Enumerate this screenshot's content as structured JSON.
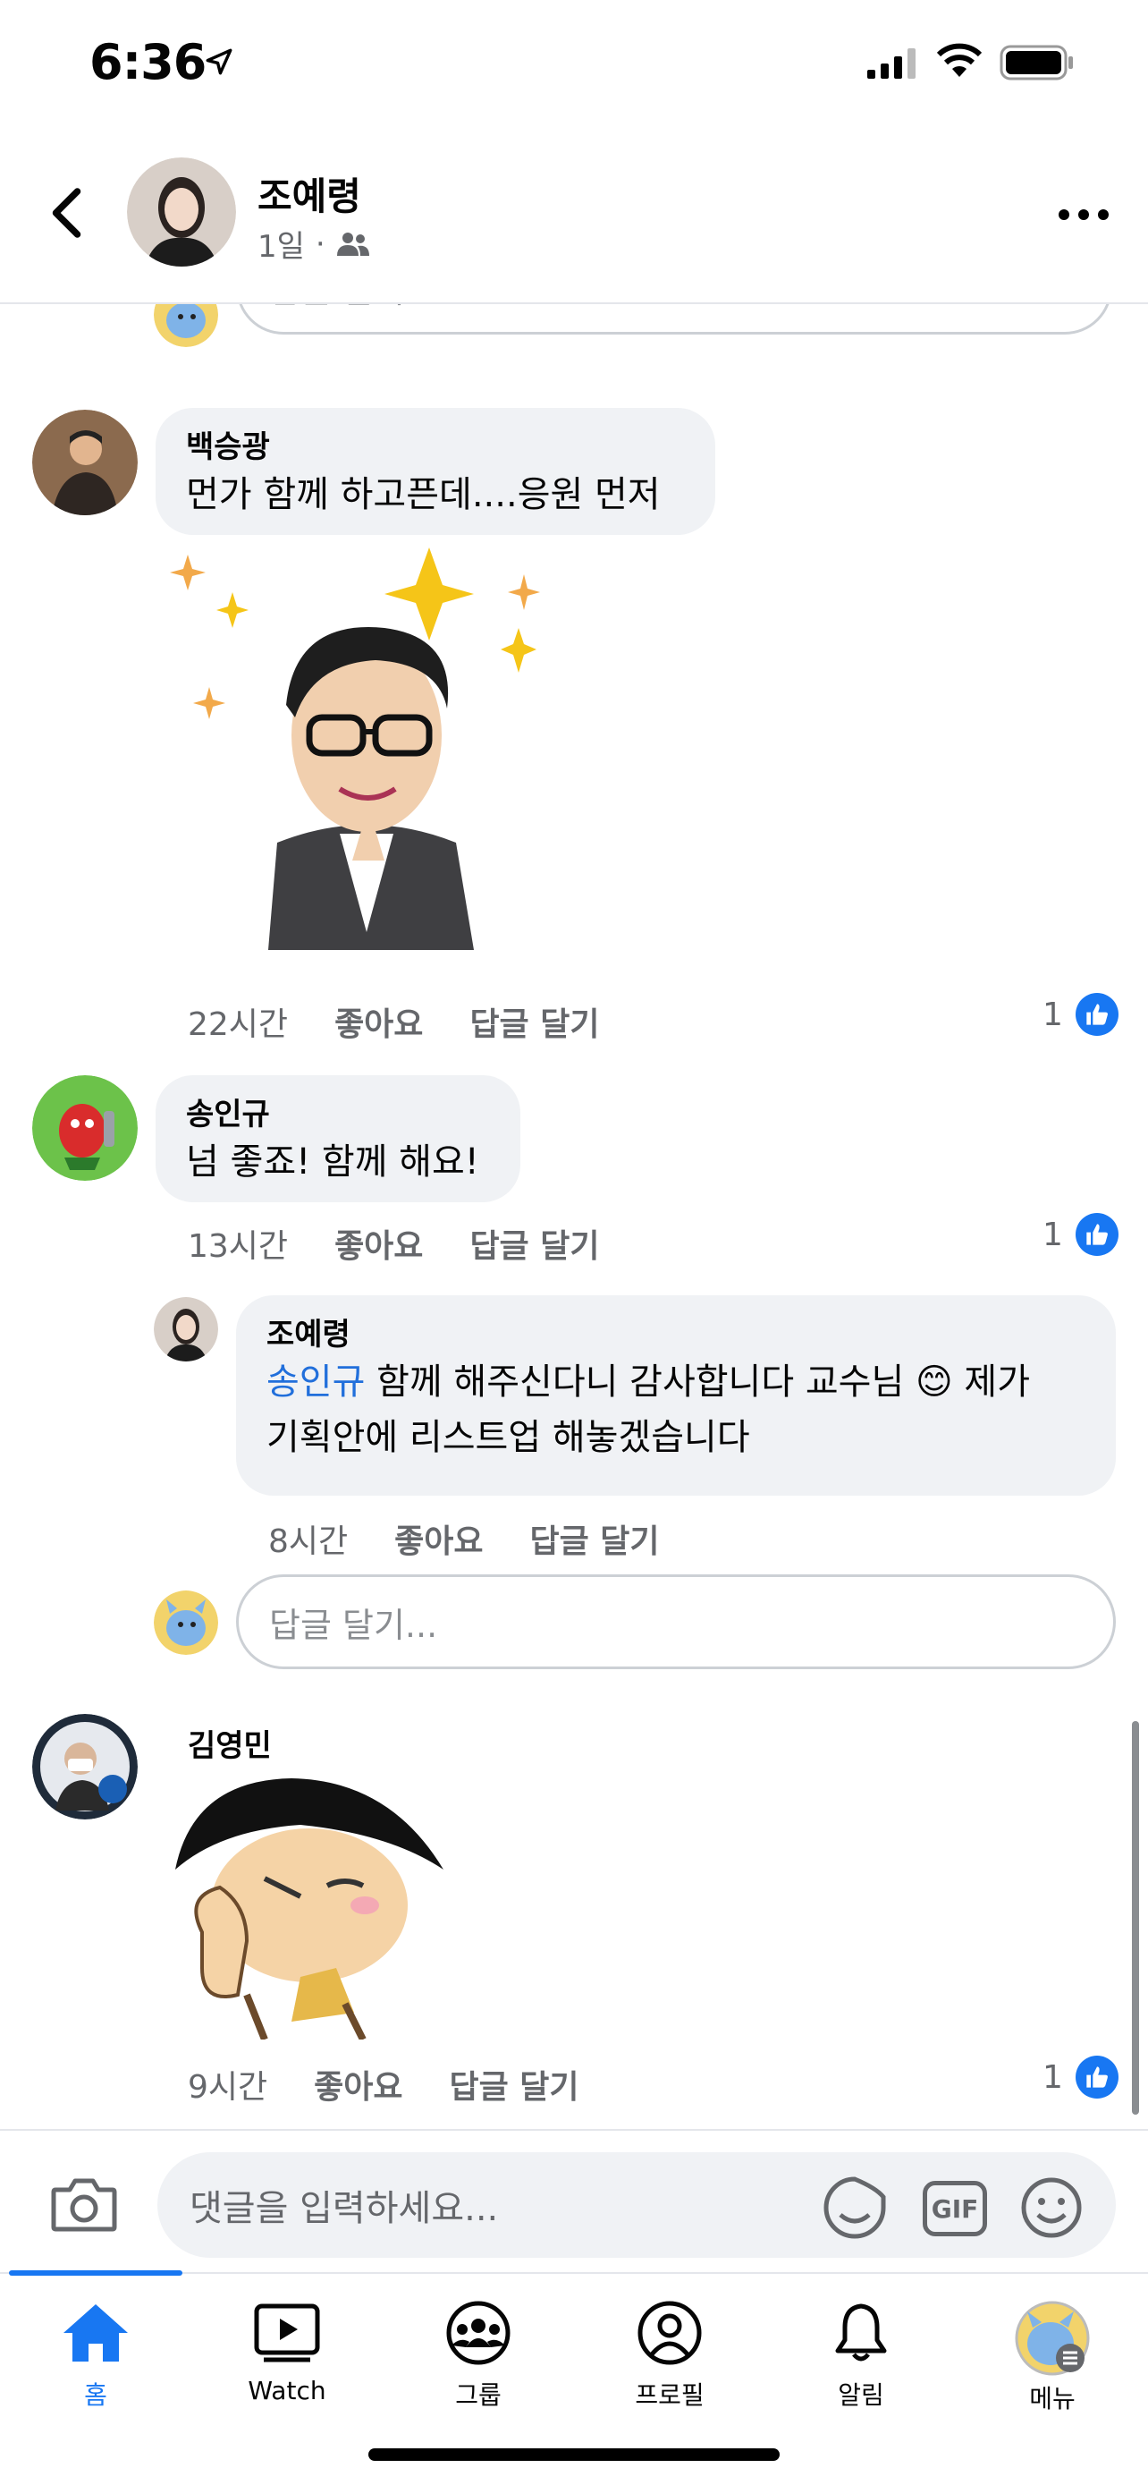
{
  "status_bar": {
    "time": "6:36"
  },
  "header": {
    "name": "조예령",
    "time": "1일",
    "dot": "·"
  },
  "top_reply_placeholder": "답글 달기...",
  "comments": [
    {
      "author": "백승광",
      "text": "먼가 함께 하고픈데....응원 먼저",
      "time": "22시간",
      "like": "좋아요",
      "reply": "답글 달기",
      "likes": "1"
    },
    {
      "author": "송인규",
      "text": "넘 좋죠! 함께 해요!",
      "time": "13시간",
      "like": "좋아요",
      "reply": "답글 달기",
      "likes": "1"
    },
    {
      "author": "김영민",
      "time": "9시간",
      "like": "좋아요",
      "reply": "답글 달기",
      "likes": "1"
    }
  ],
  "reply": {
    "author": "조예령",
    "mention": "송인규",
    "text1": " 함께 해주신다니 감사합니다 교수님 ",
    "emoji": "😊",
    "text2": " 제가",
    "text3": "기획안에 리스트업 해놓겠습니다",
    "time": "8시간",
    "like": "좋아요",
    "reply": "답글 달기"
  },
  "reply_placeholder": "답글 달기...",
  "comment_input": {
    "placeholder": "댓글을 입력하세요...",
    "gif": "GIF"
  },
  "tabs": [
    {
      "label": "홈",
      "icon": "home-icon"
    },
    {
      "label": "Watch",
      "icon": "watch-icon"
    },
    {
      "label": "그룹",
      "icon": "groups-icon"
    },
    {
      "label": "프로필",
      "icon": "profile-icon"
    },
    {
      "label": "알림",
      "icon": "bell-icon"
    },
    {
      "label": "메뉴",
      "icon": "menu-avatar"
    }
  ],
  "colors": {
    "accent": "#1877f2",
    "bubble": "#f0f2f5",
    "muted": "#65676b"
  }
}
